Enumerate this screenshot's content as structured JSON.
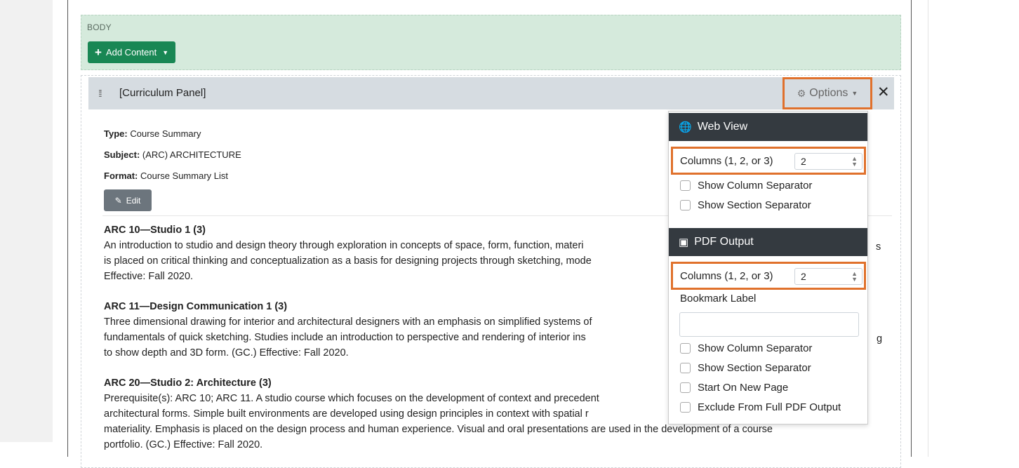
{
  "body": {
    "label": "BODY",
    "add_content": "Add Content"
  },
  "panel": {
    "title": "[Curriculum Panel]",
    "options_label": "Options",
    "close": "✕",
    "type_key": "Type:",
    "type_value": "Course Summary",
    "subject_key": "Subject:",
    "subject_value": "(ARC) ARCHITECTURE",
    "format_key": "Format:",
    "format_value": "Course Summary List",
    "edit_label": "Edit"
  },
  "courses": [
    {
      "title": "ARC 10—Studio 1 (3)",
      "lines": [
        "An introduction to studio and design theory through exploration in concepts of space, form, function, materi",
        "is placed on critical thinking and conceptualization as a basis for designing projects through sketching, mode",
        "Effective: Fall 2020."
      ],
      "tail": "s"
    },
    {
      "title": "ARC 11—Design Communication 1 (3)",
      "lines": [
        "Three dimensional drawing for interior and architectural designers with an emphasis on simplified systems of",
        "fundamentals of quick sketching. Studies include an introduction to perspective and rendering of interior ins",
        "to show depth and 3D form. (GC.) Effective: Fall 2020."
      ],
      "tail": "g"
    },
    {
      "title": "ARC 20—Studio 2: Architecture (3)",
      "lines": [
        "Prerequisite(s): ARC 10; ARC 11. A studio course which focuses on the development of context and precedent",
        "architectural forms. Simple built environments are developed using design principles in context with spatial r",
        "materiality. Emphasis is placed on the design process and human experience. Visual and oral presentations are used in the development of a course",
        "portfolio. (GC.) Effective: Fall 2020."
      ]
    }
  ],
  "dropdown": {
    "web_view": {
      "heading": "Web View",
      "columns_label": "Columns (1, 2, or 3)",
      "columns_value": "2",
      "show_column_separator": "Show Column Separator",
      "show_section_separator": "Show Section Separator"
    },
    "pdf_output": {
      "heading": "PDF Output",
      "columns_label": "Columns (1, 2, or 3)",
      "columns_value": "2",
      "bookmark_label": "Bookmark Label",
      "bookmark_value": "",
      "show_column_separator": "Show Column Separator",
      "show_section_separator": "Show Section Separator",
      "start_on_new_page": "Start On New Page",
      "exclude_from_full_pdf": "Exclude From Full PDF Output"
    }
  },
  "colors": {
    "accent_green": "#198754",
    "highlight_orange": "#e0712c",
    "dark_header": "#343a40"
  }
}
